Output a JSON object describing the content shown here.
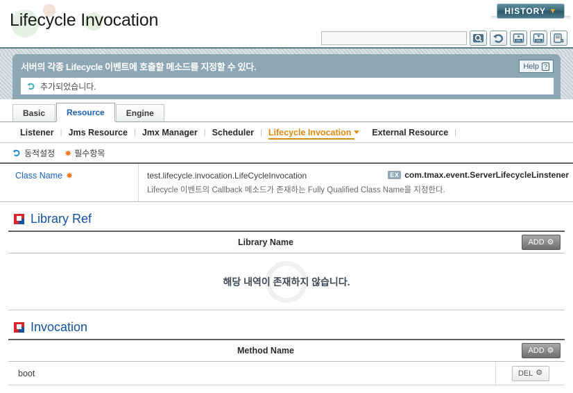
{
  "header": {
    "title": "Lifecycle Invocation",
    "history_label": "HISTORY",
    "history_caret": "chevron-down-icon",
    "search_value": "",
    "search_placeholder": "",
    "tools": [
      {
        "name": "search-icon",
        "title": "Search"
      },
      {
        "name": "refresh-icon",
        "title": "Refresh"
      },
      {
        "name": "xml-upload-icon",
        "title": "XML Up"
      },
      {
        "name": "xml-download-icon",
        "title": "XML Down"
      },
      {
        "name": "export-doc-icon",
        "title": "Export"
      }
    ]
  },
  "notice": {
    "title": "서버의 각종 Lifecycle 이벤트에 호출할 메소드를 지정할 수 있다.",
    "help_label": "Help",
    "help_mark": "?",
    "status_text": "추가되었습니다.",
    "status_icon": "refresh-icon"
  },
  "main_tabs": [
    {
      "label": "Basic",
      "active": false
    },
    {
      "label": "Resource",
      "active": true
    },
    {
      "label": "Engine",
      "active": false
    }
  ],
  "subnav": [
    {
      "label": "Listener",
      "active": false
    },
    {
      "label": "Jms Resource",
      "active": false
    },
    {
      "label": "Jmx Manager",
      "active": false
    },
    {
      "label": "Scheduler",
      "active": false
    },
    {
      "label": "Lifecycle Invocation",
      "active": true
    },
    {
      "label": "External Resource",
      "active": false
    }
  ],
  "legend": {
    "dynamic_label": "동적설정",
    "required_label": "필수항목",
    "required_mark": "✸"
  },
  "property": {
    "label": "Class Name",
    "required_mark": "✸",
    "value": "test.lifecycle.invocation.LifeCycleInvocation",
    "description": "Lifecycle 이벤트의 Callback 메소드가 존재하는 Fully Qualified Class Name을 지정한다.",
    "example_badge": "EX",
    "example_value": "com.tmax.event.ServerLifecycleLinstener"
  },
  "library_ref": {
    "title": "Library Ref",
    "column_header": "Library Name",
    "add_label": "ADD",
    "empty_text": "해당 내역이 존재하지 않습니다."
  },
  "invocation": {
    "title": "Invocation",
    "column_header": "Method Name",
    "add_label": "ADD",
    "rows": [
      {
        "method_name": "boot",
        "delete_label": "DEL"
      }
    ]
  },
  "colors": {
    "accent_blue": "#14529e",
    "accent_orange": "#e08a10",
    "notice_bg": "#8ea7b4",
    "history_teal": "#3d6b7d",
    "required_orange": "#f07c1e"
  }
}
